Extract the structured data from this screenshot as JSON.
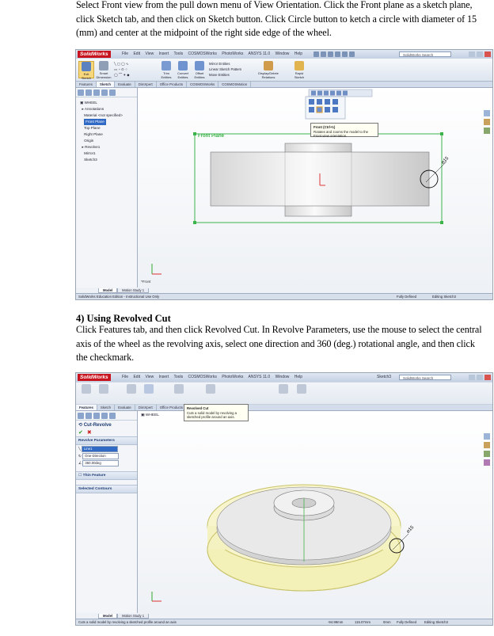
{
  "step3_text": "Select Front view from the pull down menu of View Orientation. Click the Front plane as a sketch plane, click Sketch tab, and then click on Sketch button. Click Circle button to ketch a circle with diameter of 15 (mm) and center at the midpoint of the right side edge of the wheel.",
  "step4_heading": "4) Using Revolved Cut",
  "step4_text": "Click Features tab, and then click Revolved Cut. In Revolve Parameters, use the mouse to select the central axis of the wheel as the revolving axis, select one direction and 360 (deg.) rotational angle, and then click the checkmark.",
  "app": {
    "logo": "SolidWorks",
    "menus": [
      "File",
      "Edit",
      "View",
      "Insert",
      "Tools",
      "COSMOSWorks",
      "PhotoWorks",
      "ANSYS 11.0",
      "Window",
      "Help"
    ],
    "search_placeholder": "SolidWorks Search",
    "doc_name": "Sketch3"
  },
  "shot1": {
    "ribbon": {
      "exit_sketch": "Exit Sketch",
      "smart_dimension": "Smart Dimension",
      "trim_entities": "Trim Entities",
      "convert_entities": "Convert Entities",
      "offset_entities": "Offset Entities",
      "mirror_entities": "Mirror Entities",
      "linear_pattern": "Linear Sketch Pattern",
      "move_entities": "Move Entities",
      "display_delete": "Display/Delete Relations",
      "rapid_sketch": "Rapid Sketch"
    },
    "tabs": [
      "Features",
      "Sketch",
      "Evaluate",
      "DimXpert",
      "Office Products",
      "COSMOSWorks",
      "COSMOSMotion"
    ],
    "tree": [
      "WHEEL",
      "Annotations",
      "Material <not specified>",
      "Front Plane",
      "Top Plane",
      "Right Plane",
      "Origin",
      "Revolve1",
      "Mirror1",
      "Sketch3"
    ],
    "selected_tree_item": "Front Plane",
    "tooltip_title": "Front (Ctrl+1)",
    "tooltip_body": "Rotates and zooms the model to the Front view orientation.",
    "plane_label": "Front Plane",
    "dimension": "⌀15",
    "view_label": "*Front",
    "bottom_tabs": [
      "Model",
      "Motion Study 1"
    ],
    "status_left": "SolidWorks Education Edition - Instructional Use Only",
    "status_right_1": "Fully Defined",
    "status_right_2": "Editing Sketch3"
  },
  "shot2": {
    "tooltip_title": "Revolved Cut",
    "tooltip_body": "Cuts a solid model by revolving a sketched profile around an axis.",
    "pm_title": "Cut-Revolve",
    "section_params": "Revolve Parameters",
    "axis_value": "Line1",
    "direction_value": "One-Direction",
    "angle_value": "360.00deg",
    "section_thin": "Thin Feature",
    "section_contours": "Selected Contours",
    "tree_root": "WHEEL",
    "dimension": "⌀15",
    "tabs": [
      "Features",
      "Sketch",
      "Evaluate",
      "DimXpert",
      "Office Products"
    ],
    "bottom_tabs": [
      "Model",
      "Motion Study 1"
    ],
    "status_left": "Cuts a solid model by revolving a sketched profile around an axis",
    "status_coord_1": "-94.99mm",
    "status_coord_2": "115.07mm",
    "status_coord_3": "0mm",
    "status_right_1": "Fully Defined",
    "status_right_2": "Editing Sketch3"
  }
}
